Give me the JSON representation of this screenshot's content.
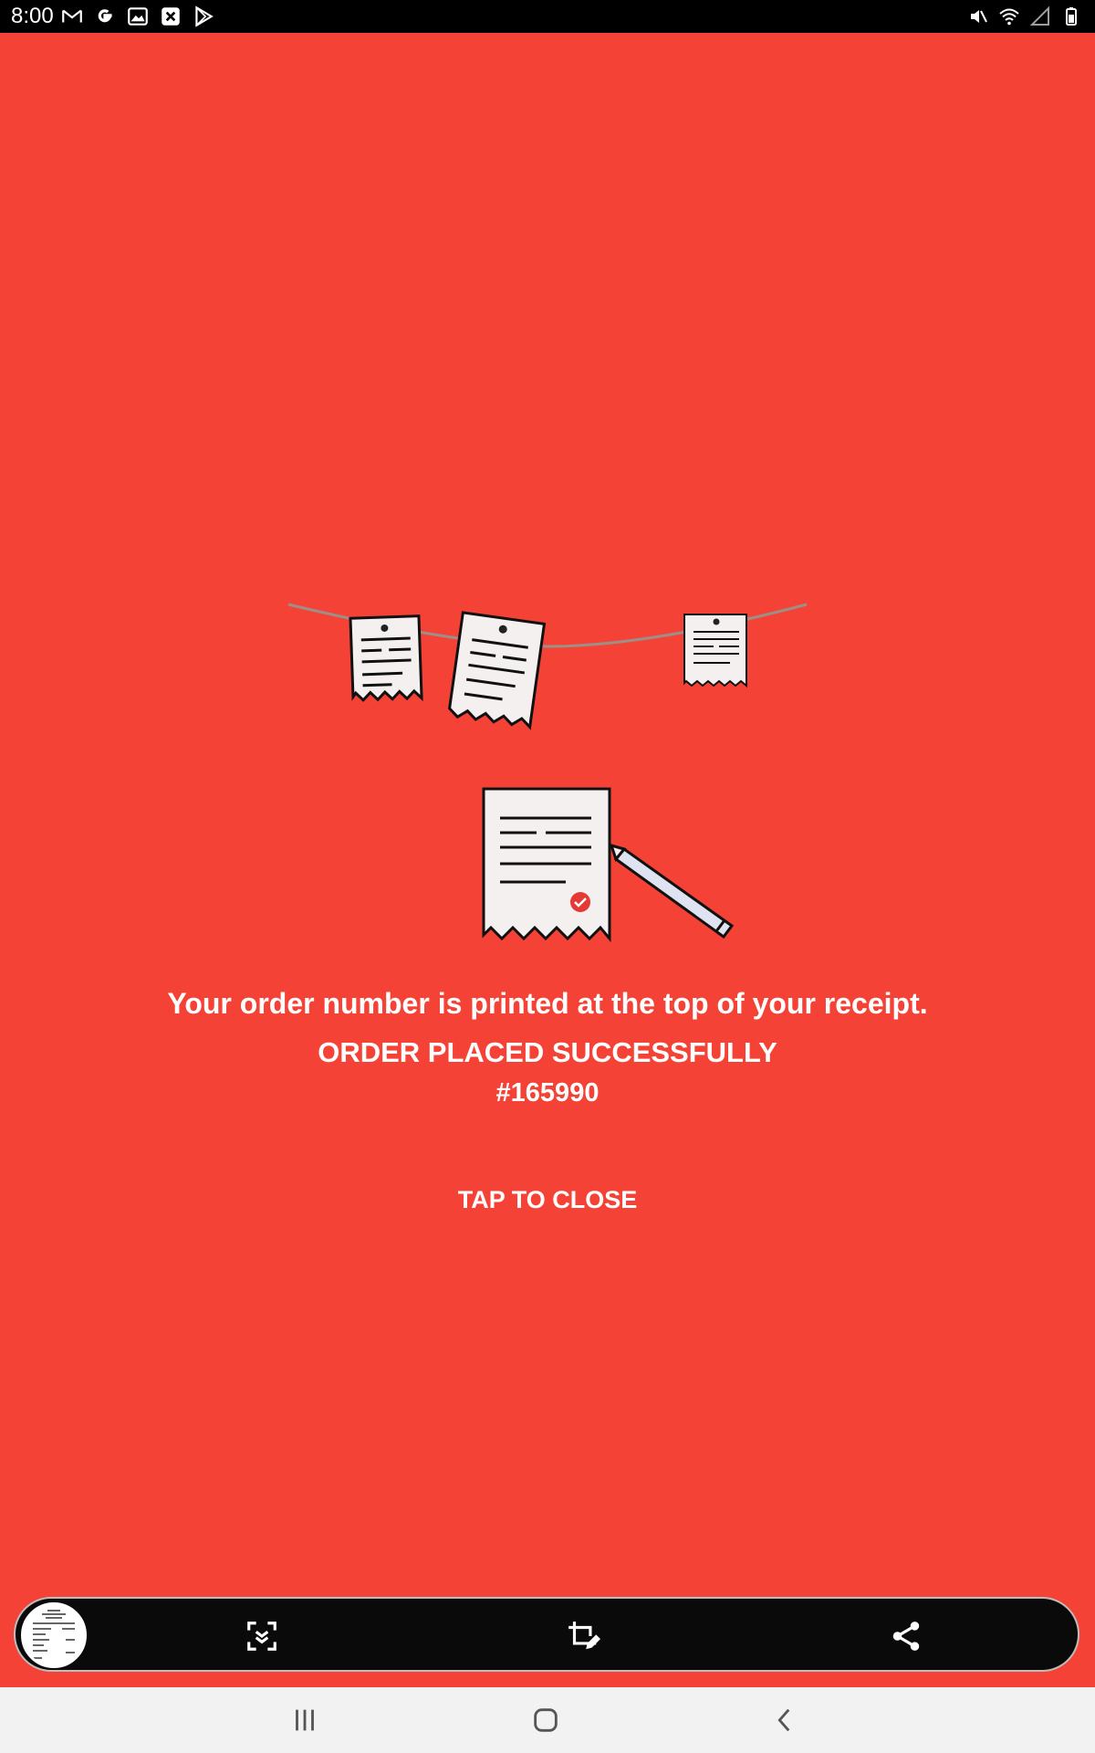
{
  "status_bar": {
    "time": "8:00",
    "left_icons": [
      "gmail-icon",
      "google-icon",
      "gallery-icon",
      "close-box-icon",
      "play-store-icon"
    ],
    "right_icons": [
      "mute-icon",
      "wifi-icon",
      "signal-icon",
      "battery-icon"
    ]
  },
  "order": {
    "info_message": "Your order number is printed at the top of your receipt.",
    "status_message": "ORDER PLACED SUCCESSFULLY",
    "order_number": "#165990",
    "close_label": "TAP TO CLOSE"
  },
  "screenshot_toolbar": {
    "buttons": [
      "scroll-capture-icon",
      "crop-edit-icon",
      "share-icon"
    ]
  },
  "navigation_bar": {
    "buttons": [
      "recent-apps-icon",
      "home-icon",
      "back-icon"
    ]
  },
  "colors": {
    "background": "#f44336",
    "text": "#ffffff",
    "status_bar": "#000000",
    "check_badge": "#e53935"
  }
}
